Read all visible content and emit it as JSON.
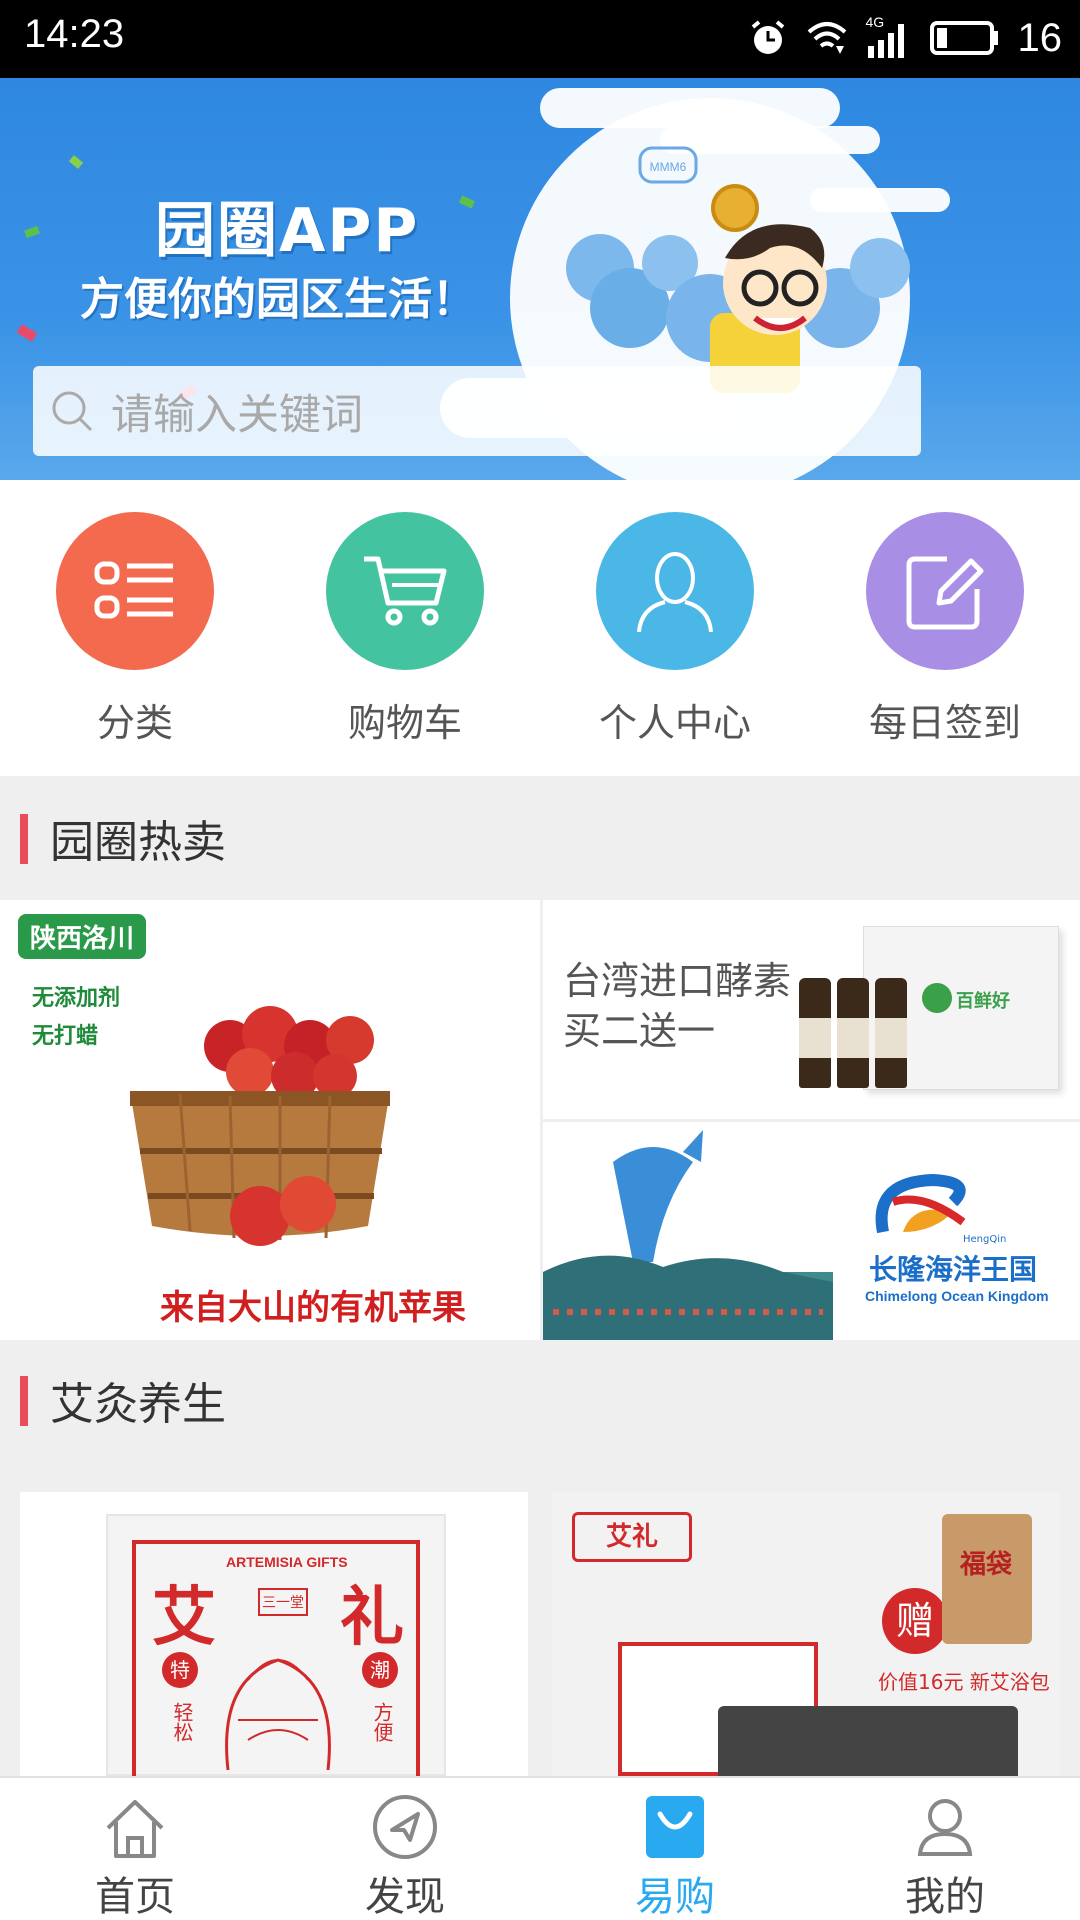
{
  "status_bar": {
    "time": "14:23",
    "signal": "4G",
    "battery": "16"
  },
  "banner": {
    "title": "园圈APP",
    "subtitle": "方便你的园区生活！",
    "badge": "MMM6"
  },
  "search": {
    "placeholder": "请输入关键词"
  },
  "quick_menu": [
    {
      "label": "分类",
      "icon": "list-icon",
      "color": "#f36a4e"
    },
    {
      "label": "购物车",
      "icon": "cart-icon",
      "color": "#44c3a0"
    },
    {
      "label": "个人中心",
      "icon": "person-icon",
      "color": "#4bb7e6"
    },
    {
      "label": "每日签到",
      "icon": "edit-icon",
      "color": "#a98ee6"
    }
  ],
  "sections": {
    "hot": {
      "title": "园圈热卖"
    },
    "moxa": {
      "title": "艾灸养生"
    }
  },
  "hot_items": {
    "apple": {
      "tag": "陕西洛川",
      "note1": "无添加剂",
      "note2": "无打蜡",
      "caption": "来自大山的有机苹果"
    },
    "enzyme": {
      "line1": "台湾进口酵素",
      "line2": "买二送一",
      "brand": "百鲜好"
    },
    "ocean": {
      "brand_cn": "长隆海洋王国",
      "brand_en": "Chimelong Ocean Kingdom",
      "brand_small": "HengQin"
    }
  },
  "moxa_items": {
    "gift1": {
      "c1": "艾",
      "c2": "礼",
      "en": "ARTEMISIA GIFTS",
      "side1": "特",
      "side2": "轻松",
      "side3": "潮",
      "side4": "方便",
      "center": "三一堂"
    },
    "gift2": {
      "logo": "艾礼",
      "gift": "赠",
      "pack": "福袋",
      "note": "价值16元 新艾浴包"
    }
  },
  "bottom_nav": [
    {
      "label": "首页",
      "icon": "home-icon",
      "active": false
    },
    {
      "label": "发现",
      "icon": "compass-icon",
      "active": false
    },
    {
      "label": "易购",
      "icon": "shopping-bag-icon",
      "active": true
    },
    {
      "label": "我的",
      "icon": "user-icon",
      "active": false
    }
  ]
}
